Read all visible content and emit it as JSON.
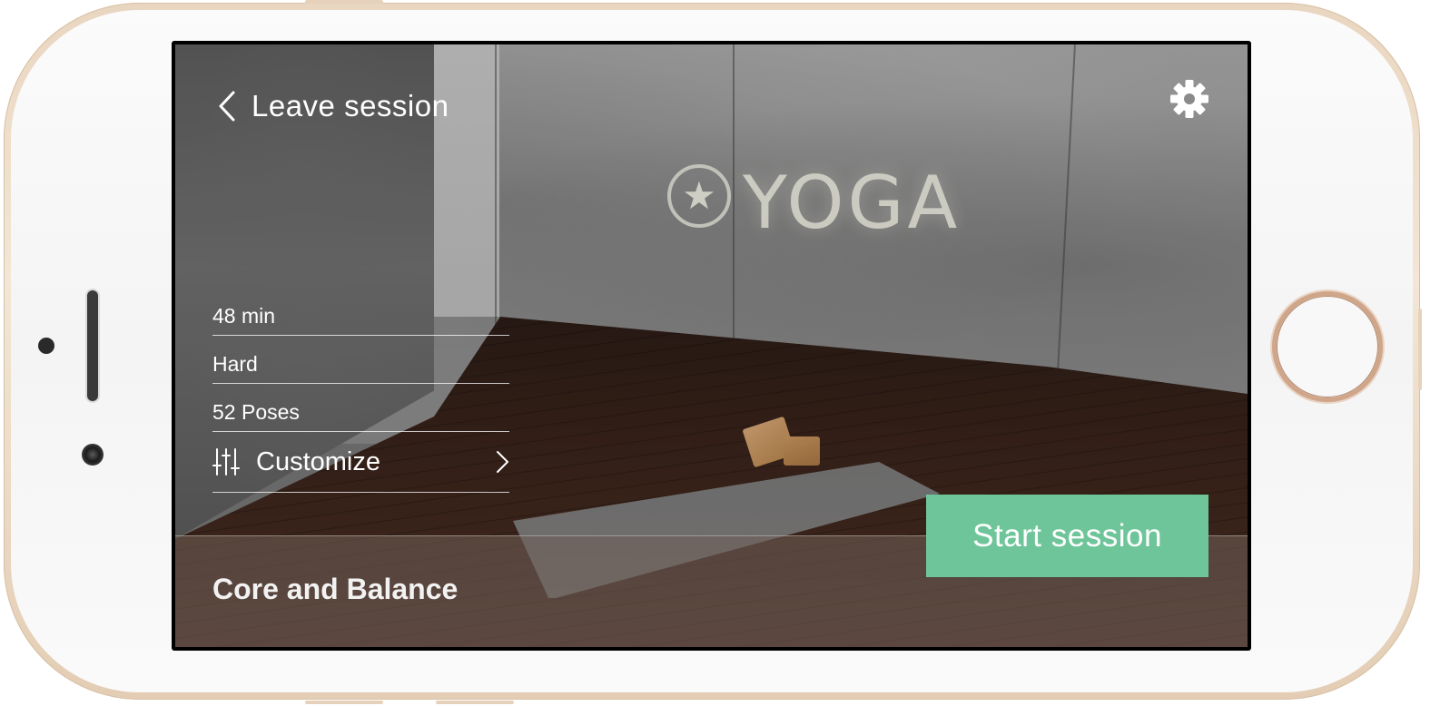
{
  "header": {
    "back_label": "Leave session",
    "back_icon": "chevron-left-icon",
    "settings_icon": "gear-icon"
  },
  "background": {
    "wall_text": "YOGA",
    "wall_symbol": "★"
  },
  "session_info": {
    "duration": "48 min",
    "difficulty": "Hard",
    "poses": "52 Poses",
    "customize_label": "Customize",
    "customize_icon": "sliders-icon",
    "customize_chevron": "chevron-right-icon"
  },
  "footer": {
    "session_title": "Core and Balance",
    "start_label": "Start session"
  },
  "colors": {
    "accent": "#6fc59a",
    "text": "#ffffff"
  }
}
